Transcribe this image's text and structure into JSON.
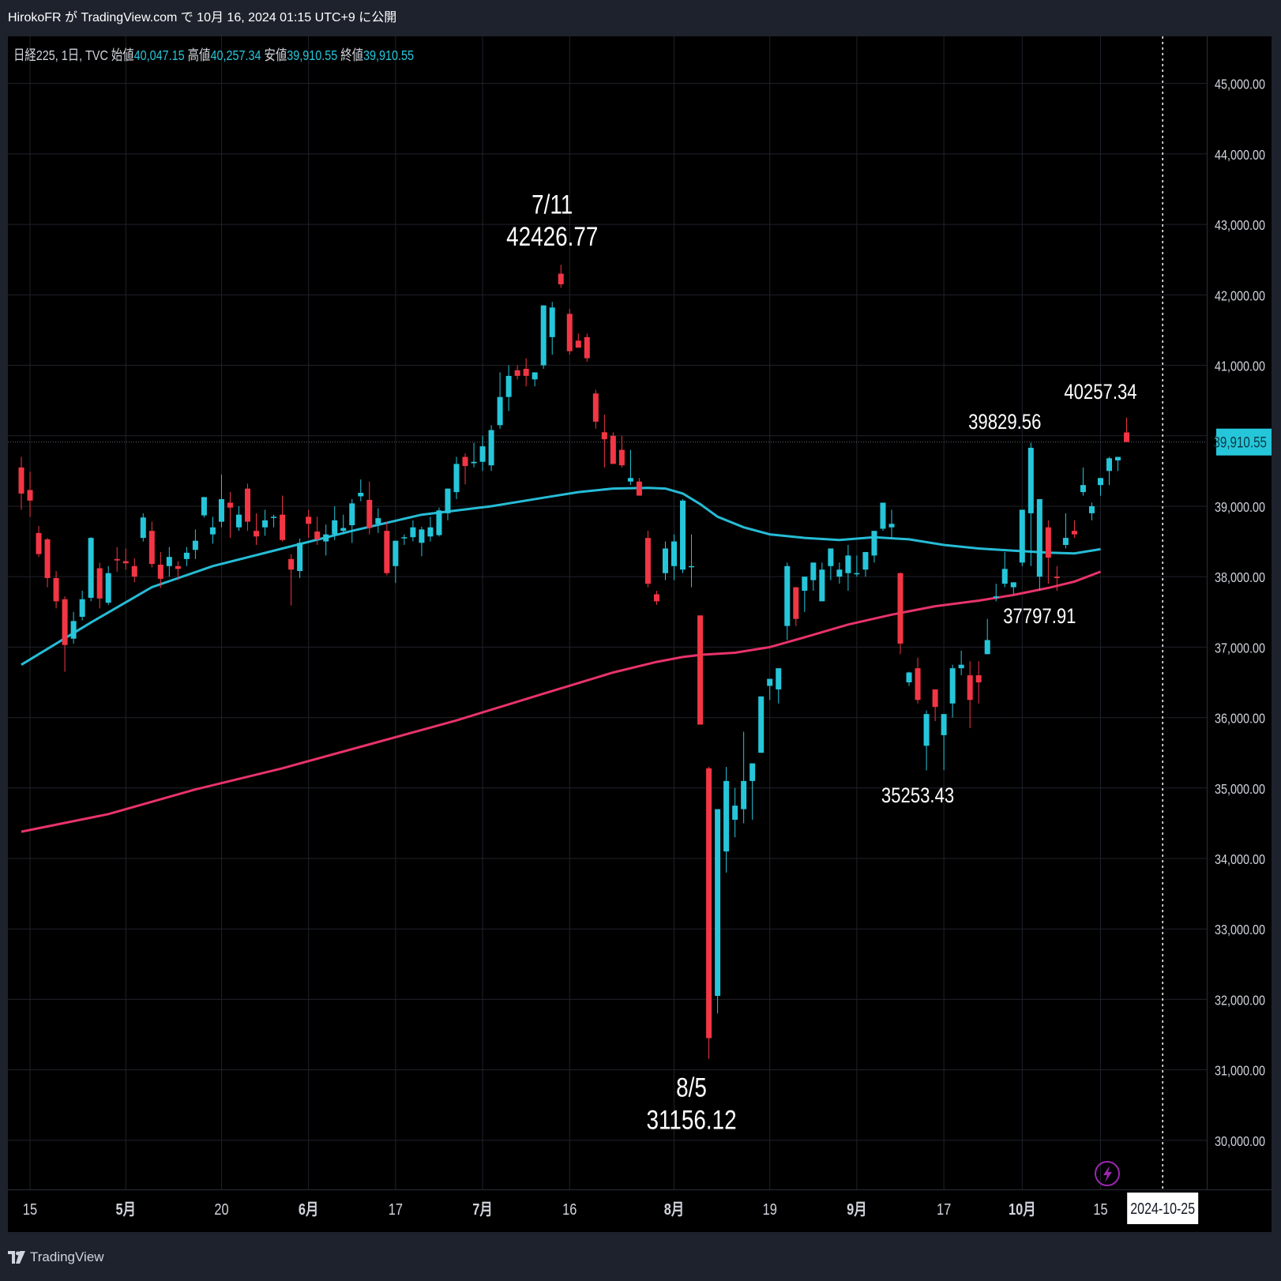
{
  "header": {
    "text": "HirokoFR が TradingView.com で 10月 16, 2024 01:15 UTC+9 に公開"
  },
  "footer": {
    "brand": "TradingView"
  },
  "icons": {
    "alert": "lightning-bolt-icon",
    "brand": "tradingview-logo-icon"
  },
  "colors": {
    "up": "#26c6da",
    "down": "#f23645",
    "ma_short": "#26bcd6",
    "ma_long": "#e8336a",
    "price_tag": "#26c6da",
    "grid": "#1f222a",
    "axis_text": "#d1d4dc",
    "alert_icon": "#9c27b0"
  },
  "chart_data": {
    "type": "candlestick",
    "symbol_line": {
      "symbol": "日経225, 1日, TVC",
      "open_label": "始値",
      "open": "40,047.15",
      "high_label": "高値",
      "high": "40,257.34",
      "low_label": "安値",
      "low": "39,910.55",
      "close_label": "終値",
      "close": "39,910.55"
    },
    "ylim": [
      29550,
      45400
    ],
    "y_ticks": [
      30000,
      31000,
      32000,
      33000,
      34000,
      35000,
      36000,
      37000,
      38000,
      39000,
      40000,
      41000,
      42000,
      43000,
      44000,
      45000
    ],
    "y_tick_labels": [
      "30,000.00",
      "31,000.00",
      "32,000.00",
      "33,000.00",
      "34,000.00",
      "35,000.00",
      "36,000.00",
      "37,000.00",
      "38,000.00",
      "39,000.00",
      "40,000.00",
      "41,000.00",
      "42,000.00",
      "43,000.00",
      "44,000.00",
      "45,000.00"
    ],
    "last_price": 39910.55,
    "last_price_label": "39,910.55",
    "x_ticks": [
      {
        "label": "15",
        "date": "2024-04-15"
      },
      {
        "label": "5月",
        "date": "2024-05-01"
      },
      {
        "label": "20",
        "date": "2024-05-20"
      },
      {
        "label": "6月",
        "date": "2024-06-03"
      },
      {
        "label": "17",
        "date": "2024-06-17"
      },
      {
        "label": "7月",
        "date": "2024-07-01"
      },
      {
        "label": "16",
        "date": "2024-07-16"
      },
      {
        "label": "8月",
        "date": "2024-08-01"
      },
      {
        "label": "19",
        "date": "2024-08-19"
      },
      {
        "label": "9月",
        "date": "2024-09-02"
      },
      {
        "label": "17",
        "date": "2024-09-17"
      },
      {
        "label": "10月",
        "date": "2024-10-01"
      },
      {
        "label": "15",
        "date": "2024-10-15"
      }
    ],
    "crosshair_date": "2024-10-25",
    "dates": [
      "2024-04-12",
      "2024-04-15",
      "2024-04-16",
      "2024-04-17",
      "2024-04-18",
      "2024-04-19",
      "2024-04-22",
      "2024-04-23",
      "2024-04-24",
      "2024-04-25",
      "2024-04-26",
      "2024-04-30",
      "2024-05-01",
      "2024-05-02",
      "2024-05-07",
      "2024-05-08",
      "2024-05-09",
      "2024-05-10",
      "2024-05-13",
      "2024-05-14",
      "2024-05-15",
      "2024-05-16",
      "2024-05-17",
      "2024-05-20",
      "2024-05-21",
      "2024-05-22",
      "2024-05-23",
      "2024-05-24",
      "2024-05-27",
      "2024-05-28",
      "2024-05-29",
      "2024-05-30",
      "2024-05-31",
      "2024-06-03",
      "2024-06-04",
      "2024-06-05",
      "2024-06-06",
      "2024-06-07",
      "2024-06-10",
      "2024-06-11",
      "2024-06-12",
      "2024-06-13",
      "2024-06-14",
      "2024-06-17",
      "2024-06-18",
      "2024-06-19",
      "2024-06-20",
      "2024-06-21",
      "2024-06-24",
      "2024-06-25",
      "2024-06-26",
      "2024-06-27",
      "2024-06-28",
      "2024-07-01",
      "2024-07-02",
      "2024-07-03",
      "2024-07-04",
      "2024-07-05",
      "2024-07-08",
      "2024-07-09",
      "2024-07-10",
      "2024-07-11",
      "2024-07-12",
      "2024-07-16",
      "2024-07-17",
      "2024-07-18",
      "2024-07-19",
      "2024-07-22",
      "2024-07-23",
      "2024-07-24",
      "2024-07-25",
      "2024-07-26",
      "2024-07-29",
      "2024-07-30",
      "2024-07-31",
      "2024-08-01",
      "2024-08-02",
      "2024-08-05",
      "2024-08-06",
      "2024-08-07",
      "2024-08-08",
      "2024-08-09",
      "2024-08-13",
      "2024-08-14",
      "2024-08-15",
      "2024-08-16",
      "2024-08-19",
      "2024-08-20",
      "2024-08-21",
      "2024-08-22",
      "2024-08-23",
      "2024-08-26",
      "2024-08-27",
      "2024-08-28",
      "2024-08-29",
      "2024-08-30",
      "2024-09-02",
      "2024-09-03",
      "2024-09-04",
      "2024-09-05",
      "2024-09-06",
      "2024-09-09",
      "2024-09-10",
      "2024-09-11",
      "2024-09-12",
      "2024-09-13",
      "2024-09-17",
      "2024-09-18",
      "2024-09-19",
      "2024-09-20",
      "2024-09-24",
      "2024-09-25",
      "2024-09-26",
      "2024-09-27",
      "2024-09-30",
      "2024-10-01",
      "2024-10-02",
      "2024-10-03",
      "2024-10-04",
      "2024-10-07",
      "2024-10-08",
      "2024-10-09",
      "2024-10-10",
      "2024-10-11",
      "2024-10-15"
    ],
    "ohlc": [
      [
        39550,
        39700,
        38950,
        39180
      ],
      [
        39230,
        39490,
        38850,
        39080
      ],
      [
        38620,
        38720,
        38280,
        38320
      ],
      [
        38530,
        38550,
        37850,
        37980
      ],
      [
        37980,
        38080,
        37550,
        37650
      ],
      [
        37680,
        37720,
        36650,
        37030
      ],
      [
        37120,
        37500,
        37050,
        37370
      ],
      [
        37430,
        37800,
        37380,
        37680
      ],
      [
        37700,
        38560,
        37650,
        38550
      ],
      [
        38120,
        38200,
        37550,
        37690
      ],
      [
        37630,
        38150,
        37600,
        38050
      ],
      [
        38250,
        38420,
        38070,
        38230
      ],
      [
        38220,
        38400,
        38100,
        38190
      ],
      [
        38150,
        38260,
        37920,
        38000
      ],
      [
        38550,
        38900,
        38500,
        38840
      ],
      [
        38650,
        38780,
        38130,
        38180
      ],
      [
        38170,
        38350,
        37840,
        37970
      ],
      [
        38150,
        38420,
        38000,
        38280
      ],
      [
        38150,
        38220,
        37950,
        38110
      ],
      [
        38250,
        38420,
        38150,
        38340
      ],
      [
        38380,
        38670,
        38250,
        38510
      ],
      [
        38870,
        39050,
        38840,
        39130
      ],
      [
        38600,
        38850,
        38470,
        38700
      ],
      [
        38780,
        39450,
        38700,
        39100
      ],
      [
        39050,
        39200,
        38550,
        38980
      ],
      [
        38700,
        39000,
        38650,
        38880
      ],
      [
        39250,
        39320,
        38650,
        38780
      ],
      [
        38650,
        38900,
        38450,
        38570
      ],
      [
        38700,
        38950,
        38580,
        38800
      ],
      [
        38850,
        38880,
        38700,
        38850
      ],
      [
        38880,
        39150,
        38500,
        38520
      ],
      [
        38250,
        38320,
        37590,
        38100
      ],
      [
        38080,
        38540,
        37980,
        38480
      ],
      [
        38850,
        38950,
        38550,
        38750
      ],
      [
        38640,
        38850,
        38450,
        38530
      ],
      [
        38500,
        38740,
        38300,
        38600
      ],
      [
        38600,
        39000,
        38520,
        38800
      ],
      [
        38650,
        38880,
        38600,
        38690
      ],
      [
        38730,
        39100,
        38480,
        39040
      ],
      [
        39140,
        39380,
        39070,
        39190
      ],
      [
        39090,
        39350,
        38600,
        38690
      ],
      [
        38750,
        38970,
        38620,
        38830
      ],
      [
        38650,
        38780,
        38020,
        38050
      ],
      [
        38150,
        38300,
        37910,
        38510
      ],
      [
        38550,
        38600,
        38450,
        38560
      ],
      [
        38560,
        38800,
        38500,
        38700
      ],
      [
        38480,
        38710,
        38290,
        38670
      ],
      [
        38570,
        38850,
        38500,
        38700
      ],
      [
        38590,
        38980,
        38570,
        38940
      ],
      [
        38900,
        39250,
        38800,
        39250
      ],
      [
        39200,
        39700,
        39100,
        39600
      ],
      [
        39700,
        39750,
        39310,
        39570
      ],
      [
        39610,
        39900,
        39550,
        39630
      ],
      [
        39630,
        40000,
        39500,
        39850
      ],
      [
        39580,
        40150,
        39500,
        40080
      ],
      [
        40150,
        40900,
        40100,
        40550
      ],
      [
        40550,
        41000,
        40350,
        40850
      ],
      [
        40930,
        41000,
        40800,
        40850
      ],
      [
        40950,
        41100,
        40700,
        40850
      ],
      [
        40800,
        40900,
        40700,
        40900
      ],
      [
        41000,
        41850,
        40950,
        41850
      ],
      [
        41400,
        41900,
        41150,
        41820
      ],
      [
        42300,
        42426.77,
        42100,
        42150
      ],
      [
        41730,
        41800,
        41150,
        41200
      ],
      [
        41350,
        41450,
        41250,
        41250
      ],
      [
        41400,
        41450,
        41050,
        41100
      ],
      [
        40600,
        40650,
        40100,
        40200
      ],
      [
        40050,
        40300,
        39550,
        39950
      ],
      [
        40000,
        40050,
        39600,
        39600
      ],
      [
        39800,
        40000,
        39550,
        39580
      ],
      [
        39350,
        39800,
        39300,
        39400
      ],
      [
        39350,
        39400,
        39200,
        39150
      ],
      [
        38550,
        38650,
        37850,
        37900
      ],
      [
        37750,
        37800,
        37600,
        37650
      ],
      [
        38050,
        38500,
        37950,
        38400
      ],
      [
        38150,
        38600,
        37950,
        38500
      ],
      [
        38100,
        39100,
        38050,
        39080
      ],
      [
        38150,
        38600,
        37850,
        38150
      ],
      [
        37450,
        37450,
        35900,
        35900
      ],
      [
        35280,
        35300,
        31156.12,
        31450
      ],
      [
        32050,
        34500,
        31800,
        34700
      ],
      [
        34100,
        35300,
        33800,
        35100
      ],
      [
        34550,
        35000,
        34300,
        34750
      ],
      [
        34700,
        35800,
        34500,
        35100
      ],
      [
        35100,
        35350,
        34550,
        35350
      ],
      [
        35500,
        36300,
        35500,
        36300
      ],
      [
        36450,
        36550,
        36250,
        36550
      ],
      [
        36400,
        36700,
        36200,
        36700
      ],
      [
        37300,
        38200,
        37100,
        38150
      ],
      [
        37850,
        37850,
        37300,
        37400
      ],
      [
        37800,
        38000,
        37500,
        38000
      ],
      [
        37950,
        38200,
        37800,
        38200
      ],
      [
        37650,
        38200,
        37700,
        38100
      ],
      [
        38150,
        38250,
        37950,
        38400
      ],
      [
        38000,
        38200,
        37900,
        38100
      ],
      [
        38050,
        38450,
        37800,
        38300
      ],
      [
        38050,
        38300,
        38000,
        38050
      ],
      [
        38100,
        38350,
        38000,
        38350
      ],
      [
        38300,
        38400,
        38200,
        38650
      ],
      [
        38680,
        39050,
        38650,
        39050
      ],
      [
        38700,
        38950,
        38550,
        38750
      ],
      [
        38050,
        38060,
        36900,
        37050
      ],
      [
        36500,
        36650,
        36450,
        36640
      ],
      [
        36700,
        36850,
        36200,
        36250
      ],
      [
        35600,
        36100,
        35250,
        36050
      ],
      [
        36400,
        36400,
        35950,
        36150
      ],
      [
        35750,
        36050,
        35253.43,
        36050
      ],
      [
        36200,
        36750,
        36000,
        36700
      ],
      [
        36700,
        36950,
        36600,
        36750
      ],
      [
        36600,
        36800,
        35850,
        36250
      ],
      [
        36600,
        36800,
        36200,
        36500
      ],
      [
        36900,
        37400,
        36900,
        37100
      ],
      [
        37700,
        37900,
        37650,
        37720
      ],
      [
        37900,
        38350,
        37850,
        38110
      ],
      [
        37850,
        37900,
        37750,
        37920
      ],
      [
        38200,
        38900,
        38150,
        38950
      ],
      [
        38900,
        39900,
        38150,
        39829.56
      ],
      [
        38000,
        38000,
        37800,
        39100
      ],
      [
        38700,
        38800,
        37900,
        38270
      ],
      [
        38000,
        38150,
        37797.91,
        37980
      ],
      [
        38450,
        38900,
        38400,
        38550
      ],
      [
        38650,
        38800,
        38550,
        38600
      ],
      [
        39200,
        39550,
        39150,
        39300
      ],
      [
        38900,
        39050,
        38800,
        39000
      ],
      [
        39300,
        39400,
        39150,
        39400
      ],
      [
        39500,
        39700,
        39300,
        39680
      ],
      [
        39650,
        39700,
        39500,
        39700
      ],
      [
        40047.15,
        40257.34,
        39910.55,
        39910.55
      ]
    ],
    "ma_short": {
      "name": "",
      "points": [
        [
          0,
          36750
        ],
        [
          8,
          37350
        ],
        [
          15,
          37850
        ],
        [
          22,
          38150
        ],
        [
          30,
          38400
        ],
        [
          38,
          38650
        ],
        [
          46,
          38880
        ],
        [
          54,
          39000
        ],
        [
          60,
          39120
        ],
        [
          64,
          39200
        ],
        [
          68,
          39250
        ],
        [
          72,
          39260
        ],
        [
          74,
          39250
        ],
        [
          76,
          39180
        ],
        [
          78,
          39030
        ],
        [
          80,
          38850
        ],
        [
          83,
          38700
        ],
        [
          86,
          38600
        ],
        [
          90,
          38550
        ],
        [
          94,
          38520
        ],
        [
          98,
          38560
        ],
        [
          102,
          38530
        ],
        [
          106,
          38450
        ],
        [
          110,
          38400
        ],
        [
          114,
          38370
        ],
        [
          118,
          38340
        ],
        [
          121,
          38330
        ],
        [
          124,
          38390
        ]
      ]
    },
    "ma_long": {
      "name": "",
      "points": [
        [
          0,
          34380
        ],
        [
          10,
          34630
        ],
        [
          20,
          34980
        ],
        [
          30,
          35280
        ],
        [
          40,
          35620
        ],
        [
          50,
          35960
        ],
        [
          60,
          36340
        ],
        [
          68,
          36640
        ],
        [
          73,
          36790
        ],
        [
          76,
          36860
        ],
        [
          78,
          36890
        ],
        [
          82,
          36920
        ],
        [
          86,
          37000
        ],
        [
          90,
          37140
        ],
        [
          95,
          37320
        ],
        [
          100,
          37460
        ],
        [
          105,
          37580
        ],
        [
          110,
          37660
        ],
        [
          114,
          37740
        ],
        [
          118,
          37840
        ],
        [
          121,
          37930
        ],
        [
          124,
          38070
        ]
      ]
    },
    "annotations": [
      {
        "lines": [
          "7/11",
          "42426.77"
        ],
        "date": "2024-07-11",
        "price": 42426.77,
        "position": "above"
      },
      {
        "lines": [
          "8/5",
          "31156.12"
        ],
        "date": "2024-08-05",
        "price": 31156.12,
        "position": "below"
      },
      {
        "lines": [
          "35253.43"
        ],
        "date": "2024-09-11",
        "price": 35253.43,
        "position": "below"
      },
      {
        "lines": [
          "39829.56"
        ],
        "date": "2024-09-27",
        "price": 39829.56,
        "position": "above"
      },
      {
        "lines": [
          "37797.91"
        ],
        "date": "2024-10-03",
        "price": 37797.91,
        "position": "below"
      },
      {
        "lines": [
          "40257.34"
        ],
        "date": "2024-10-15",
        "price": 40257.34,
        "position": "above"
      }
    ]
  }
}
